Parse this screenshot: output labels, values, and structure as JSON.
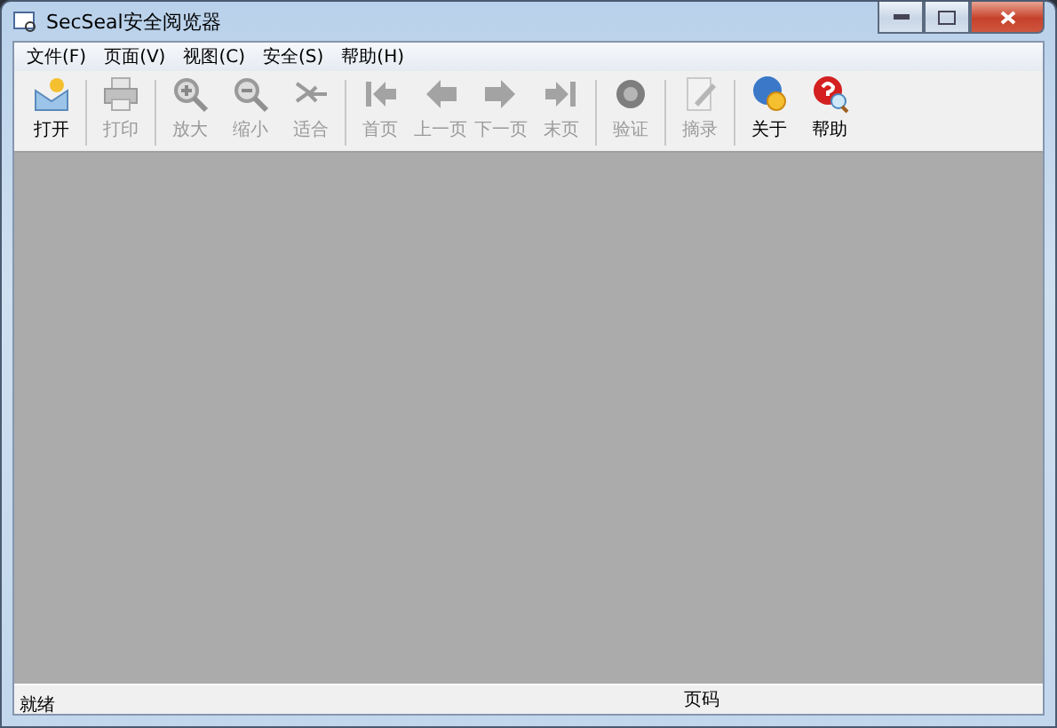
{
  "window": {
    "title": "SecSeal安全阅览器"
  },
  "menu": [
    "文件(F)",
    "页面(V)",
    "视图(C)",
    "安全(S)",
    "帮助(H)"
  ],
  "toolbar": [
    [
      {
        "label": "打开",
        "kind": "open",
        "disabled": false
      }
    ],
    [
      {
        "label": "打印",
        "kind": "print",
        "disabled": true
      }
    ],
    [
      {
        "label": "放大",
        "kind": "zoomin",
        "disabled": true
      },
      {
        "label": "缩小",
        "kind": "zoomout",
        "disabled": true
      },
      {
        "label": "适合",
        "kind": "fit",
        "disabled": true
      }
    ],
    [
      {
        "label": "首页",
        "kind": "first",
        "disabled": true
      },
      {
        "label": "上一页",
        "kind": "prev",
        "disabled": true
      },
      {
        "label": "下一页",
        "kind": "next",
        "disabled": true
      },
      {
        "label": "末页",
        "kind": "last",
        "disabled": true
      }
    ],
    [
      {
        "label": "验证",
        "kind": "verify",
        "disabled": true
      }
    ],
    [
      {
        "label": "摘录",
        "kind": "excerpt",
        "disabled": true
      }
    ],
    [
      {
        "label": "关于",
        "kind": "about",
        "disabled": false
      },
      {
        "label": "帮助",
        "kind": "help",
        "disabled": false
      }
    ]
  ],
  "status_bar": {
    "left": "就绪",
    "right": "页码"
  }
}
